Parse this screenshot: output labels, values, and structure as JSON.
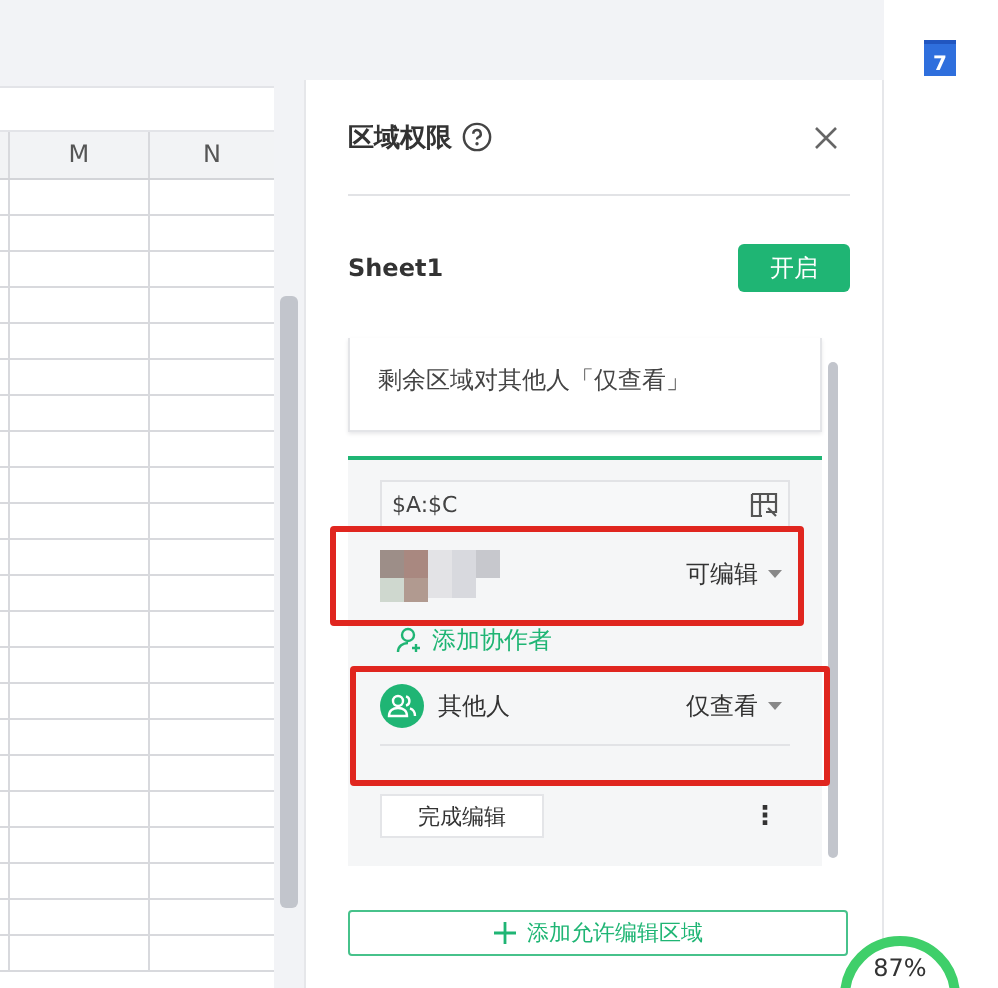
{
  "sheet": {
    "columns": [
      "M",
      "N"
    ]
  },
  "panel": {
    "title": "区域权限",
    "sheet_name": "Sheet1",
    "enable_button": "开启",
    "rest_note": "剩余区域对其他人「仅查看」",
    "region": {
      "range": "$A:$C",
      "members": [
        {
          "kind": "user",
          "name_hidden": true,
          "permission": "可编辑"
        },
        {
          "kind": "group",
          "name": "其他人",
          "permission": "仅查看"
        }
      ],
      "add_collaborator": "添加协作者",
      "done_button": "完成编辑",
      "more": "⋮"
    },
    "add_region_button": "添加允许编辑区域"
  },
  "calendar_icon": {
    "day": "7"
  },
  "gauge": {
    "reading": "87%"
  },
  "annotations": [
    {
      "kind": "highlight",
      "color": "#e0261f"
    },
    {
      "kind": "highlight",
      "color": "#e0261f"
    }
  ]
}
